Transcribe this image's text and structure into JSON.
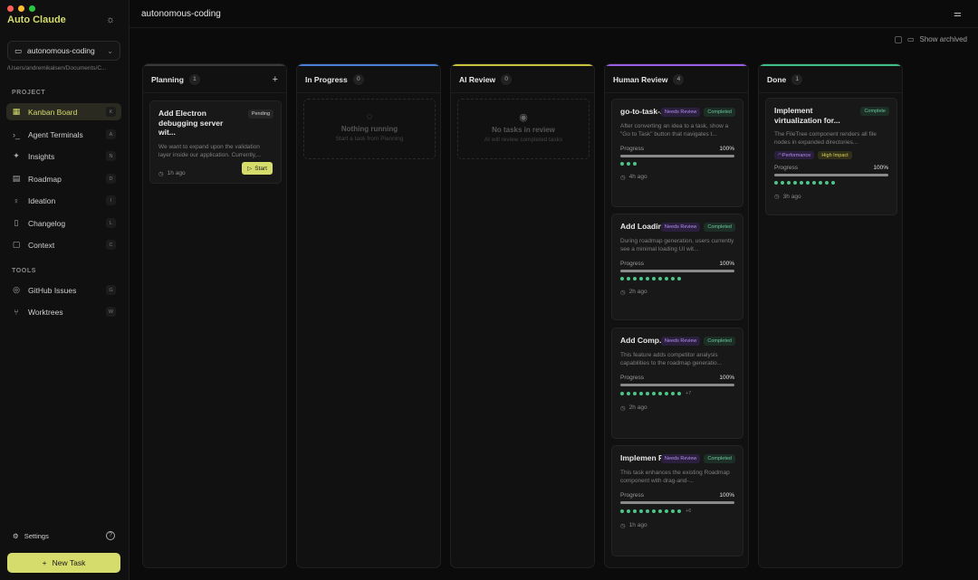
{
  "sidebar": {
    "traffic_colors": [
      "#fe5f57",
      "#febc2e",
      "#28c840"
    ],
    "app_title": "Auto Claude",
    "theme_icon": "sun-icon",
    "project_name": "autonomous-coding",
    "project_path": "/Users/andremikalsen/Documents/C...",
    "sections": {
      "project": "PROJECT",
      "tools": "TOOLS"
    },
    "project_items": [
      {
        "label": "Kanban Board",
        "icon": "grid-icon",
        "key": "K"
      },
      {
        "label": "Agent Terminals",
        "icon": "terminal-icon",
        "key": "A"
      },
      {
        "label": "Insights",
        "icon": "sparkles-icon",
        "key": "N"
      },
      {
        "label": "Roadmap",
        "icon": "map-icon",
        "key": "D"
      },
      {
        "label": "Ideation",
        "icon": "lightbulb-icon",
        "key": "I"
      },
      {
        "label": "Changelog",
        "icon": "document-icon",
        "key": "L"
      },
      {
        "label": "Context",
        "icon": "book-icon",
        "key": "C"
      }
    ],
    "tool_items": [
      {
        "label": "GitHub Issues",
        "icon": "github-icon",
        "key": "G"
      },
      {
        "label": "Worktrees",
        "icon": "git-branch-icon",
        "key": "W"
      }
    ],
    "settings_label": "Settings",
    "new_task_label": "New Task",
    "accent": "#d6dc6c"
  },
  "header": {
    "title": "autonomous-coding",
    "show_archived_label": "Show archived"
  },
  "columns": [
    {
      "name": "Planning",
      "count": "1",
      "accent": "#3a3a3a",
      "cards": [
        {
          "title": "Add Electron debugging server wit...",
          "status": "Pending",
          "description": "We want to expand upon the validation layer inside our application. Currently,...",
          "time": "1h ago",
          "start_label": "Start"
        }
      ]
    },
    {
      "name": "In Progress",
      "count": "0",
      "accent": "#4a7fd8",
      "empty_title": "Nothing running",
      "empty_sub": "Start a task from Planning"
    },
    {
      "name": "AI Review",
      "count": "0",
      "accent": "#c9c23a",
      "empty_title": "No tasks in review",
      "empty_sub": "AI will review completed tasks"
    },
    {
      "name": "Human Review",
      "count": "4",
      "accent": "#9b5de5",
      "cards": [
        {
          "title": "go-to-task-...",
          "review": "Needs Review",
          "completed": "Completed",
          "description": "After converting an idea to a task, show a \"Go to Task\" button that navigates t...",
          "progress_label": "Progress",
          "progress": "100%",
          "fill": 1.0,
          "dots": 3,
          "more": "",
          "time": "4h ago"
        },
        {
          "title": "Add Loadin...",
          "review": "Needs Review",
          "completed": "Completed",
          "description": "During roadmap generation, users currently see a minimal loading UI wit...",
          "progress_label": "Progress",
          "progress": "100%",
          "fill": 1.0,
          "dots": 10,
          "more": "",
          "time": "2h ago"
        },
        {
          "title": "Add Comp...",
          "review": "Needs Review",
          "completed": "Completed",
          "description": "This feature adds competitor analysis capabilities to the roadmap generatio...",
          "progress_label": "Progress",
          "progress": "100%",
          "fill": 1.0,
          "dots": 10,
          "more": "+7",
          "time": "2h ago"
        },
        {
          "title": "Implemen Roadm...",
          "review": "Needs Review",
          "completed": "Completed",
          "description": "This task enhances the existing Roadmap component with drag-and-...",
          "progress_label": "Progress",
          "progress": "100%",
          "fill": 1.0,
          "dots": 10,
          "more": "+6",
          "time": "1h ago"
        }
      ]
    },
    {
      "name": "Done",
      "count": "1",
      "accent": "#3fbf86",
      "cards": [
        {
          "title": "Implement virtualization for...",
          "complete": "Complete",
          "description": "The FileTree component renders all file nodes in expanded directories...",
          "tags": [
            "Performance",
            "High Impact"
          ],
          "progress_label": "Progress",
          "progress": "100%",
          "fill": 1.0,
          "dots": 10,
          "more": "",
          "time": "3h ago"
        }
      ]
    }
  ]
}
